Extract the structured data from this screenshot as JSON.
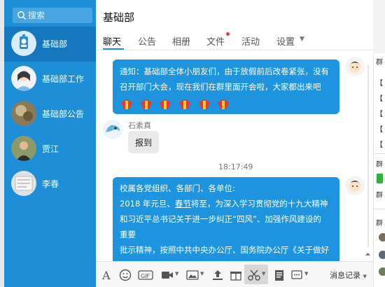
{
  "search": {
    "placeholder": "搜索"
  },
  "contacts": [
    {
      "name": "基础部"
    },
    {
      "name": "基础部工作"
    },
    {
      "name": "基础部公告"
    },
    {
      "name": "贾江"
    },
    {
      "name": "李春"
    }
  ],
  "group": {
    "title": "基础部"
  },
  "tabs": [
    {
      "label": "聊天"
    },
    {
      "label": "公告"
    },
    {
      "label": "相册"
    },
    {
      "label": "文件"
    },
    {
      "label": "活动"
    },
    {
      "label": "设置"
    }
  ],
  "messages": {
    "notice_line1": "通知：基础部全体小朋友们，由于放假前后改卷紧张，没有",
    "notice_line2": "召开部门大会，现在我们在群里面开会啦，大家都出来吧",
    "sender_name": "石素真",
    "reply_text": "报到",
    "timestamp": "18:17:49",
    "long_line1": "校属各党组织、各部门、各单位:",
    "long_line2_pre": "2018 年元旦、",
    "long_line2_link": "春节",
    "long_line2_post": "将至，为深入学习贯彻党的十九大精神",
    "long_line3": "和习近平总书记关于进一步纠正“四风”、加强作风建设的",
    "long_line4": "重要",
    "long_line5": "批示精神，按照中共中央办公厅、国务院办公厅《关于做好"
  },
  "toolbar": {
    "records_label": "消息记录"
  },
  "rightbar": {
    "chars": [
      "群",
      "【",
      "【",
      "【",
      "【",
      "【",
      "群",
      "群",
      "群"
    ]
  },
  "colors": {
    "sidebar": "#1e8fd6",
    "sidebar_active": "#1577be",
    "bubble": "#1d94dd",
    "accent_red": "#e53935"
  }
}
